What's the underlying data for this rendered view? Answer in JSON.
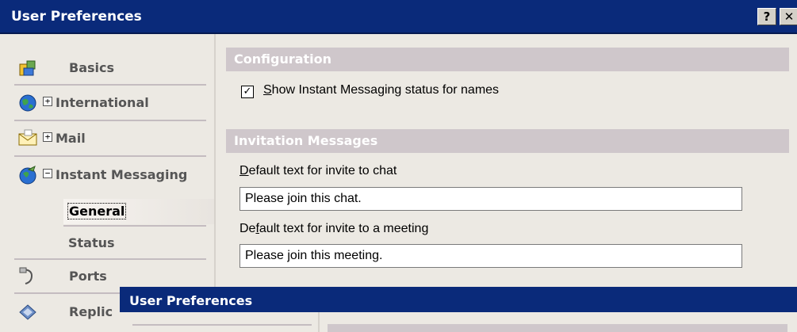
{
  "window": {
    "title": "User Preferences",
    "help_button": "?",
    "close_button": "✕"
  },
  "sidebar": {
    "items": [
      {
        "label": "Basics",
        "icon": "basics-icon",
        "toggle": ""
      },
      {
        "label": "International",
        "icon": "globe-icon",
        "toggle": "+"
      },
      {
        "label": "Mail",
        "icon": "mail-icon",
        "toggle": "+"
      },
      {
        "label": "Instant Messaging",
        "icon": "instant-messaging-icon",
        "toggle": "−"
      },
      {
        "label": "Ports",
        "icon": "ports-icon",
        "toggle": ""
      },
      {
        "label": "Replic",
        "icon": "replication-icon",
        "toggle": ""
      }
    ],
    "subitems": [
      {
        "label": "General",
        "selected": true
      },
      {
        "label": "Status",
        "selected": false
      }
    ]
  },
  "main": {
    "configuration": {
      "header": "Configuration",
      "checkbox_label": "Show Instant Messaging status for names",
      "checkbox_checked": true
    },
    "invitation": {
      "header": "Invitation Messages",
      "chat_label": "Default text for invite to chat",
      "chat_value": "Please join this chat.",
      "meeting_label": "Default text for invite to a meeting",
      "meeting_value": "Please join this meeting."
    }
  },
  "dialog2": {
    "title": "User Preferences"
  }
}
